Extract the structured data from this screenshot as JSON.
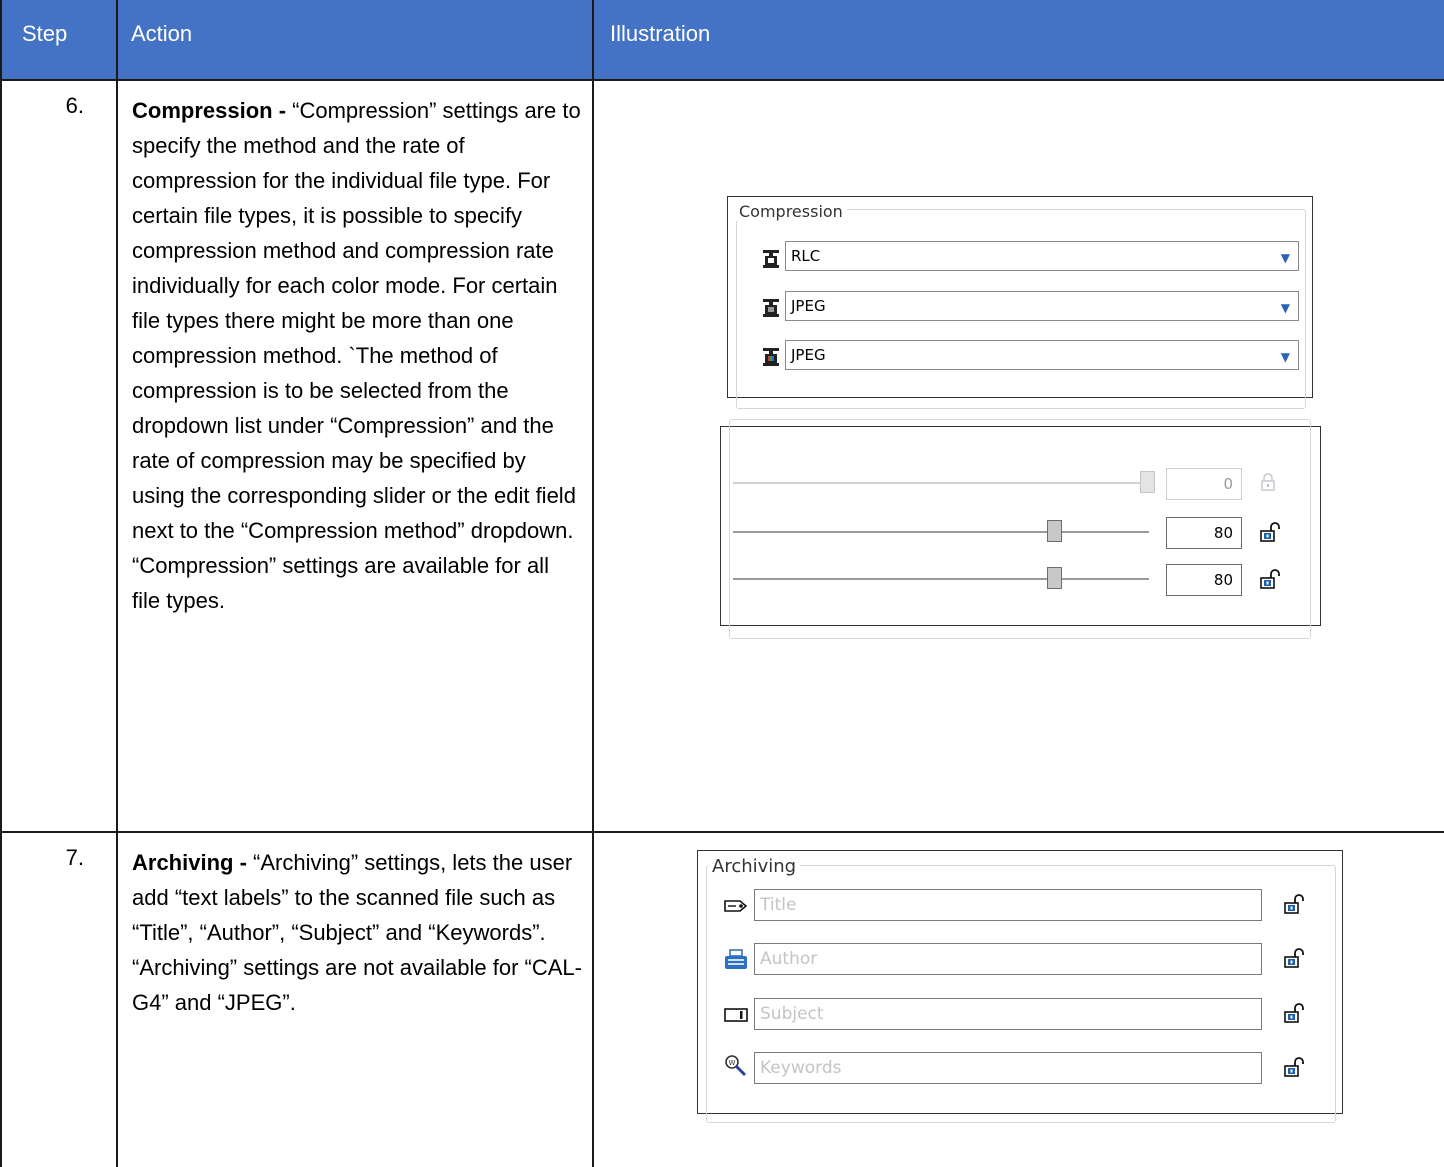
{
  "header": {
    "step": "Step",
    "action": "Action",
    "illustration": "Illustration"
  },
  "rows": [
    {
      "step": "6.",
      "action_bold": "Compression -",
      "action_text": " “Compression” settings are to specify the method and the rate of compression for the individual file type. For certain file types, it is possible to specify compression method and compression rate individually for each color mode. For certain file types there might be more than one compression method. `The method of compression is to be selected from the dropdown list under “Compression” and the rate of compression may be specified by using the corresponding slider or the edit field next to the “Compression method” dropdown. “Compression” settings are available for all file types."
    },
    {
      "step": "7.",
      "action_bold": "Archiving -",
      "action_text": " “Archiving” settings, lets the user add “text labels” to the scanned file such as “Title”, “Author”, “Subject” and “Keywords”. “Archiving” settings are not available for “CAL-G4” and “JPEG”."
    }
  ],
  "compression_panel": {
    "group_label": "Compression",
    "combos": [
      {
        "icon": "bw-scanner-icon",
        "value": "RLC"
      },
      {
        "icon": "gray-scanner-icon",
        "value": "JPEG"
      },
      {
        "icon": "color-scanner-icon",
        "value": "JPEG"
      }
    ]
  },
  "rate_panel": {
    "sliders": [
      {
        "value": "0",
        "enabled": false,
        "level_percent": 100
      },
      {
        "value": "80",
        "enabled": true,
        "level_percent": 80
      },
      {
        "value": "80",
        "enabled": true,
        "level_percent": 80
      }
    ]
  },
  "archiving_panel": {
    "group_label": "Archiving",
    "fields": [
      {
        "icon": "tag-icon",
        "placeholder": "Title"
      },
      {
        "icon": "typewriter-icon",
        "placeholder": "Author"
      },
      {
        "icon": "textbox-icon",
        "placeholder": "Subject"
      },
      {
        "icon": "keyword-search-icon",
        "placeholder": "Keywords"
      }
    ]
  },
  "colors": {
    "header_bg": "#4472C4",
    "lock_blue": "#1f5fa8"
  }
}
